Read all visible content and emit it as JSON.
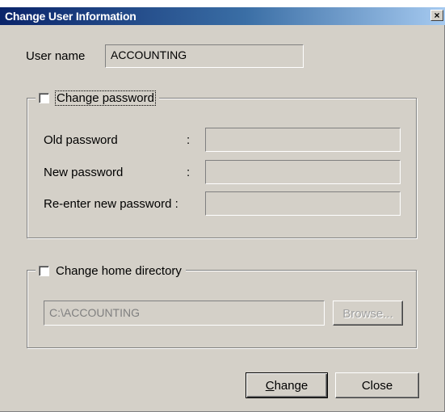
{
  "window": {
    "title": "Change User Information",
    "close_glyph": "×"
  },
  "user": {
    "label": "User name",
    "value": "ACCOUNTING"
  },
  "password_group": {
    "checkbox_label": "Change password",
    "checked": false,
    "fields": [
      {
        "label": "Old  password",
        "colon": ":",
        "value": ""
      },
      {
        "label": "New password",
        "colon": ":",
        "value": ""
      },
      {
        "label": "Re-enter new password :",
        "colon": "",
        "value": ""
      }
    ]
  },
  "home_group": {
    "checkbox_label": "Change home directory",
    "checked": false,
    "path_value": "C:\\ACCOUNTING",
    "browse_label": "Browse..."
  },
  "buttons": {
    "change_mnemonic": "C",
    "change_rest": "hange",
    "close_label": "Close"
  },
  "colors": {
    "face": "#d4d0c8",
    "title_start": "#0a246a",
    "title_end": "#a6caf0"
  }
}
